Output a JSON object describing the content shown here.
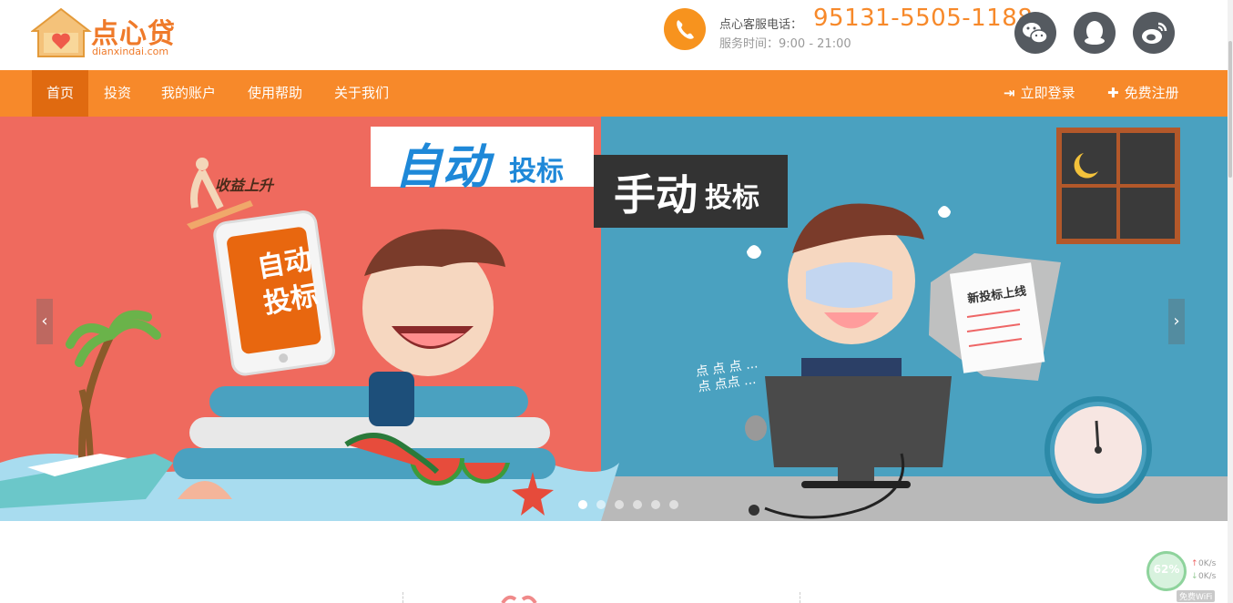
{
  "brand": {
    "name": "点心贷",
    "domain": "dianxindai.com"
  },
  "contact": {
    "phone_label": "点心客服电话：",
    "phone_number": "95131-5505-1188",
    "hours": "服务时间：9:00 - 21:00"
  },
  "social": {
    "items": [
      "wechat-icon",
      "qq-icon",
      "weibo-icon"
    ]
  },
  "nav": {
    "items": [
      {
        "label": "首页",
        "active": true
      },
      {
        "label": "投资",
        "active": false
      },
      {
        "label": "我的账户",
        "active": false
      },
      {
        "label": "使用帮助",
        "active": false
      },
      {
        "label": "关于我们",
        "active": false
      }
    ],
    "login": "立即登录",
    "register": "免费注册"
  },
  "banner": {
    "auto_big": "自动",
    "auto_small": "投标",
    "manual_big": "手动",
    "manual_small": "投标",
    "rise": "收益上升",
    "phone_screen_line1": "自动",
    "phone_screen_line2": "投标",
    "notice": "新投标上线",
    "dots_line1": "点 点 点 ...",
    "dots_line2": "点 点点 ...",
    "prev": "‹",
    "next": "›",
    "slides": 6,
    "active_slide": 1
  },
  "wifi": {
    "percent": "62%",
    "up": "0K/s",
    "down": "0K/s",
    "label": "免费WiFi"
  },
  "colors": {
    "accent": "#f7892a",
    "nav_active": "#e06a10",
    "left_panel": "#ef6a5e",
    "right_panel": "#4aa1c0"
  }
}
